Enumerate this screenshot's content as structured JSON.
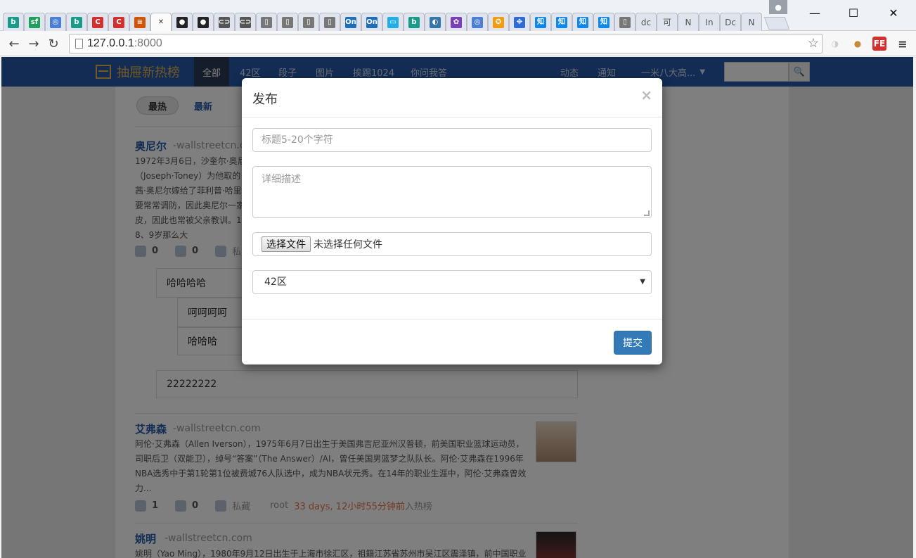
{
  "browser": {
    "tabs": [
      {
        "icon": "bing-icon",
        "glyph": "b",
        "color": "#1a9b8a"
      },
      {
        "icon": "segmentfault-icon",
        "glyph": "sf",
        "color": "#1f9e5c"
      },
      {
        "icon": "globe-icon",
        "glyph": "◎",
        "color": "#4a7fd3"
      },
      {
        "icon": "bing-icon",
        "glyph": "b",
        "color": "#1a9b8a"
      },
      {
        "icon": "c-red-icon",
        "glyph": "C",
        "color": "#d32f2f"
      },
      {
        "icon": "c-red-icon",
        "glyph": "C",
        "color": "#d32f2f"
      },
      {
        "icon": "bars-icon",
        "glyph": "≡",
        "color": "#d35400"
      },
      {
        "icon": "close-tab-icon",
        "glyph": "✕",
        "color": "#fbfbfb",
        "active": true
      },
      {
        "icon": "github-icon",
        "glyph": "●",
        "color": "#222222"
      },
      {
        "icon": "github-icon",
        "glyph": "●",
        "color": "#222222"
      },
      {
        "icon": "link-icon",
        "glyph": "⊂⊃",
        "color": "#555555"
      },
      {
        "icon": "link-icon",
        "glyph": "⊂⊃",
        "color": "#555555"
      },
      {
        "icon": "page-icon",
        "glyph": "▯",
        "color": "#777777"
      },
      {
        "icon": "page-icon",
        "glyph": "▯",
        "color": "#777777"
      },
      {
        "icon": "page-icon",
        "glyph": "▯",
        "color": "#777777"
      },
      {
        "icon": "page-icon",
        "glyph": "▯",
        "color": "#777777"
      },
      {
        "icon": "on-icon",
        "glyph": "On",
        "color": "#1e6fb8"
      },
      {
        "icon": "on-icon",
        "glyph": "On",
        "color": "#1e6fb8"
      },
      {
        "icon": "bilibili-icon",
        "glyph": "▭",
        "color": "#23ade5"
      },
      {
        "icon": "bing-icon",
        "glyph": "b",
        "color": "#1a9b8a"
      },
      {
        "icon": "python-icon",
        "glyph": "◐",
        "color": "#3776ab"
      },
      {
        "icon": "colorful-icon",
        "glyph": "✿",
        "color": "#7b3fb5"
      },
      {
        "icon": "globe-icon",
        "glyph": "◎",
        "color": "#4a7fd3"
      },
      {
        "icon": "orange-icon",
        "glyph": "✪",
        "color": "#f39c12"
      },
      {
        "icon": "baidu-paw-icon",
        "glyph": "✥",
        "color": "#2f6bd8"
      },
      {
        "icon": "zhihu-icon",
        "glyph": "知",
        "color": "#0f88eb"
      },
      {
        "icon": "zhihu-icon",
        "glyph": "知",
        "color": "#0f88eb"
      },
      {
        "icon": "zhihu-icon",
        "glyph": "知",
        "color": "#0f88eb"
      },
      {
        "icon": "zhihu-icon",
        "glyph": "知",
        "color": "#0f88eb"
      },
      {
        "icon": "page-icon",
        "glyph": "▯",
        "color": "#777777"
      },
      {
        "icon": "text-tab",
        "glyph": "dc",
        "color": "plain"
      },
      {
        "icon": "text-tab",
        "glyph": "可",
        "color": "plain"
      },
      {
        "icon": "text-tab",
        "glyph": "N",
        "color": "plain"
      },
      {
        "icon": "text-tab",
        "glyph": "In",
        "color": "plain"
      },
      {
        "icon": "text-tab",
        "glyph": "Dc",
        "color": "plain"
      },
      {
        "icon": "text-tab",
        "glyph": "N",
        "color": "plain"
      }
    ],
    "url_host": "127.0.0.1",
    "url_port": ":8000"
  },
  "site": {
    "brand": "抽屉新热榜",
    "nav": [
      "全部",
      "42区",
      "段子",
      "图片",
      "挨踢1024",
      "你问我答"
    ],
    "nav_right": [
      "动态",
      "通知",
      "一米八大高..."
    ],
    "sort": [
      "最热",
      "最新"
    ]
  },
  "feed": {
    "item1": {
      "title": "奥尼尔",
      "source": "-wallstreetcn.co",
      "desc_lines": [
        "1972年3月6日，沙奎尔·奥尼",
        "（Joseph·Toney）为他取的",
        "茜·奥尼尔嫁给了菲利普·哈里",
        "要常常调防，因此奥尼尔一家",
        "皮，因此也常被父亲教训。19",
        "8、9岁那么大"
      ],
      "likes": "0",
      "comments": "0",
      "fav": "私"
    },
    "comments": [
      "哈哈哈哈",
      "呵呵呵呵",
      "哈哈哈",
      "22222222"
    ],
    "item2": {
      "title": "艾弗森",
      "source": "-wallstreetcn.com",
      "desc_lines": [
        "阿伦·艾弗森（Allen Iverson），1975年6月7日出生于美国弗吉尼亚州汉普顿，前美国职业篮球运动员，",
        "司职后卫（双能卫），绰号“答案”（The Answer）/AI，曾任美国男篮梦之队队长。阿伦·艾弗森在1996年",
        "NBA选秀中于第1轮第1位被费城76人队选中，成为NBA状元秀。在14年的职业生涯中，阿伦·艾弗森曾效",
        "力..."
      ],
      "likes": "1",
      "comments": "0",
      "fav": "私藏",
      "user": "root",
      "time": "33 days, 12小时55分钟前",
      "suffix": "入热榜"
    },
    "item3": {
      "title": "姚明",
      "source": "-wallstreetcn.com",
      "desc_line": "姚明（Yao Ming），1980年9月12日出生于上海市徐汇区，祖籍江苏省苏州市吴江区震泽镇，前中国职业"
    }
  },
  "modal": {
    "title": "发布",
    "close": "×",
    "title_placeholder": "标题5-20个字符",
    "desc_placeholder": "详细描述",
    "file_button": "选择文件",
    "file_status": "未选择任何文件",
    "category": "42区",
    "submit": "提交"
  },
  "colors": {
    "navbar": "#2459a9",
    "brand": "#e8b34a",
    "primary_button": "#337ab7",
    "time_highlight": "#e8734a"
  }
}
